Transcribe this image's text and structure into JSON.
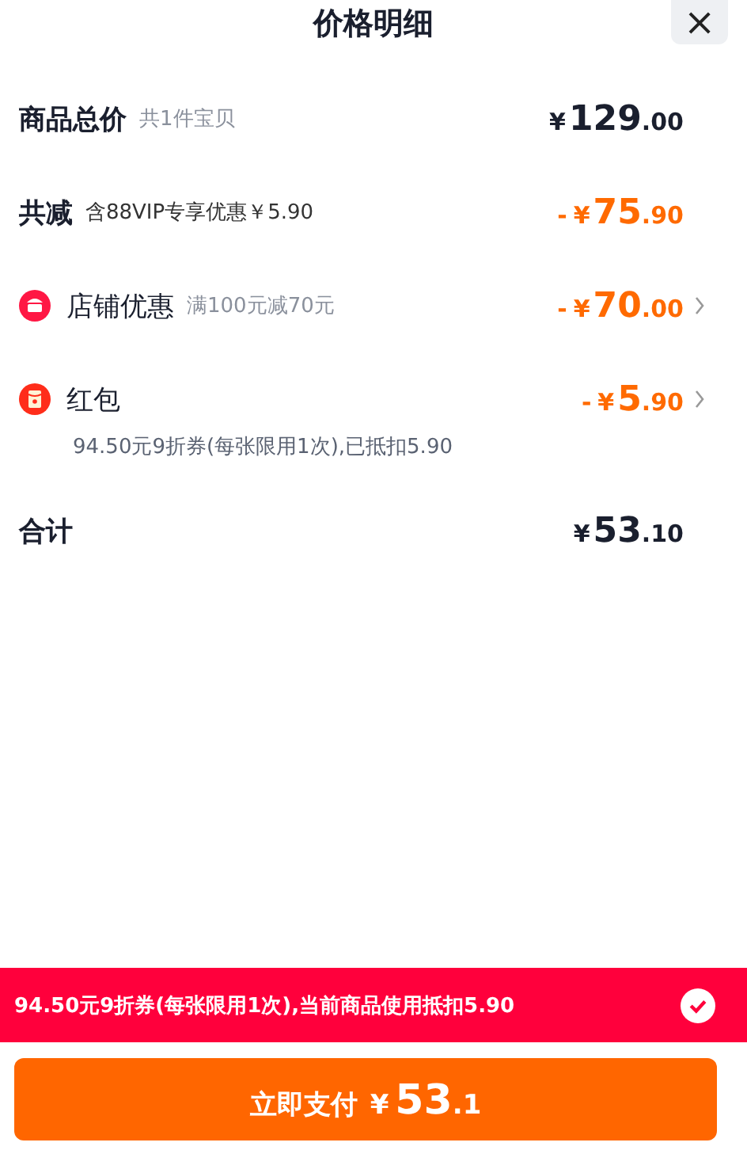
{
  "header": {
    "title": "价格明细",
    "close": "×"
  },
  "rows": [
    {
      "kind": "plain",
      "label": "商品总价",
      "note": "共1件宝贝",
      "price": {
        "currency": "¥",
        "integer": "129",
        "decimal": ".00"
      },
      "highlight": false,
      "arrow": false
    },
    {
      "kind": "plain",
      "label": "共减",
      "note": "含88VIP专享优惠￥5.90",
      "price": {
        "sign": "-",
        "currency": "¥",
        "integer": "75",
        "decimal": ".90"
      },
      "highlight": true,
      "arrow": false
    },
    {
      "kind": "shop",
      "label": "店铺优惠",
      "note": "满100元减70元",
      "price": {
        "sign": "-",
        "currency": "¥",
        "integer": "70",
        "decimal": ".00"
      },
      "highlight": true,
      "arrow": true
    },
    {
      "kind": "red_packet",
      "label": "红包",
      "detail": "94.50元9折券(每张限用1次),已抵扣5.90",
      "price": {
        "sign": "-",
        "currency": "¥",
        "integer": "5",
        "decimal": ".90"
      },
      "highlight": true,
      "arrow": true
    },
    {
      "kind": "total",
      "label": "合计",
      "price": {
        "currency": "¥",
        "integer": "53",
        "decimal": ".10"
      },
      "highlight": false,
      "arrow": false
    }
  ],
  "banner": {
    "text": "94.50元9折券(每张限用1次),当前商品使用抵扣5.90",
    "checked": true
  },
  "pay_button": {
    "label": "立即支付",
    "currency": "¥",
    "integer": "53",
    "decimal": ".1"
  }
}
